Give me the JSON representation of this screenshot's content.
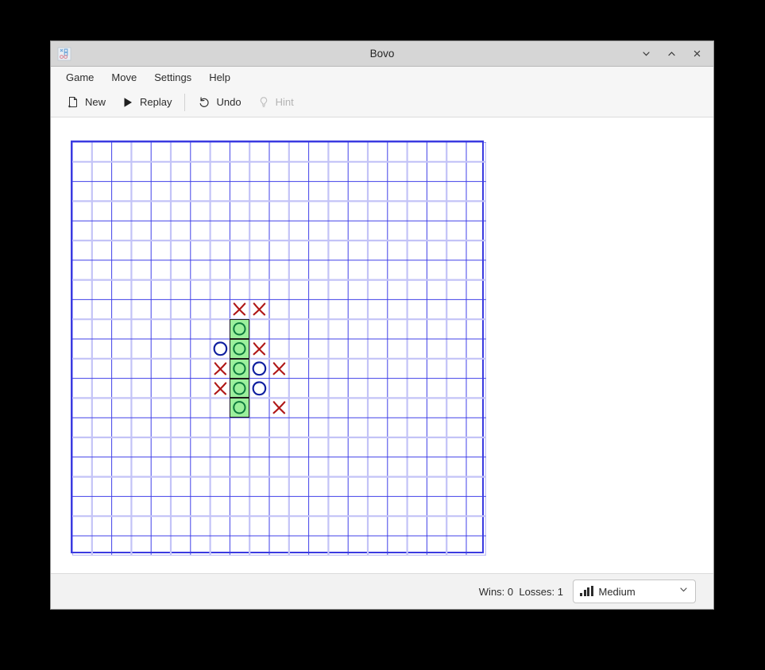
{
  "window": {
    "title": "Bovo",
    "app_icon": "bovo-tictactoe-icon",
    "controls": [
      {
        "name": "minimize-button",
        "icon": "chevron-down-icon"
      },
      {
        "name": "maximize-button",
        "icon": "chevron-up-icon"
      },
      {
        "name": "close-button",
        "icon": "close-icon"
      }
    ]
  },
  "menubar": {
    "items": [
      {
        "label": "Game"
      },
      {
        "label": "Move"
      },
      {
        "label": "Settings"
      },
      {
        "label": "Help"
      }
    ]
  },
  "toolbar": {
    "buttons": [
      {
        "label": "New",
        "icon": "new-document-icon",
        "enabled": true
      },
      {
        "label": "Replay",
        "icon": "play-triangle-icon",
        "enabled": true
      },
      {
        "label": "Undo",
        "icon": "undo-arrow-icon",
        "enabled": true
      },
      {
        "label": "Hint",
        "icon": "lightbulb-icon",
        "enabled": false
      }
    ]
  },
  "board": {
    "columns": 21,
    "rows": 21,
    "cell_size": 24.8,
    "grid_color": "#4040e8",
    "grid_minor_color": "#c3c3f7",
    "border_color": "#3a3ae0",
    "x_color": "#b01818",
    "o_color": "#0f1fa0",
    "win_fill": "#9cf09c",
    "win_mark_color": "#0d7a3d",
    "marks": [
      {
        "col": 8,
        "row": 8,
        "player": "X",
        "win": false
      },
      {
        "col": 9,
        "row": 8,
        "player": "X",
        "win": false
      },
      {
        "col": 8,
        "row": 9,
        "player": "O",
        "win": true
      },
      {
        "col": 7,
        "row": 10,
        "player": "O",
        "win": false
      },
      {
        "col": 8,
        "row": 10,
        "player": "O",
        "win": true
      },
      {
        "col": 9,
        "row": 10,
        "player": "X",
        "win": false
      },
      {
        "col": 7,
        "row": 11,
        "player": "X",
        "win": false
      },
      {
        "col": 8,
        "row": 11,
        "player": "O",
        "win": true
      },
      {
        "col": 9,
        "row": 11,
        "player": "O",
        "win": false
      },
      {
        "col": 10,
        "row": 11,
        "player": "X",
        "win": false
      },
      {
        "col": 7,
        "row": 12,
        "player": "X",
        "win": false
      },
      {
        "col": 8,
        "row": 12,
        "player": "O",
        "win": true
      },
      {
        "col": 9,
        "row": 12,
        "player": "O",
        "win": false
      },
      {
        "col": 8,
        "row": 13,
        "player": "O",
        "win": true
      },
      {
        "col": 10,
        "row": 13,
        "player": "X",
        "win": false
      }
    ]
  },
  "statusbar": {
    "score_text": "Wins: 0  Losses: 1",
    "wins": 0,
    "losses": 1,
    "difficulty": {
      "value": "Medium",
      "icon": "signal-bars-icon",
      "chevron": "chevron-down-icon"
    }
  }
}
